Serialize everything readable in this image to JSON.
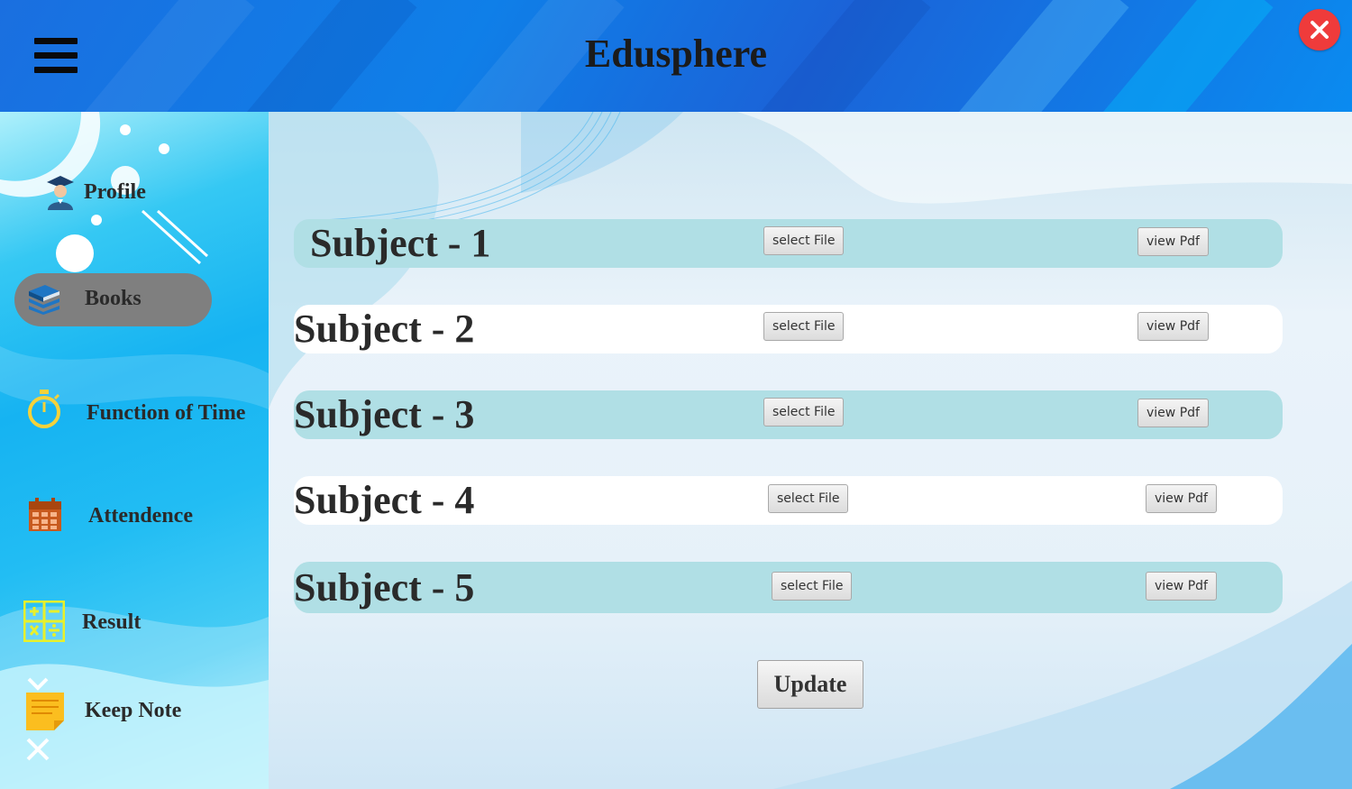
{
  "header": {
    "title": "Edusphere",
    "menu_icon": "hamburger-menu-icon",
    "close_icon": "close-icon"
  },
  "sidebar": {
    "items": [
      {
        "label": "Profile",
        "icon": "graduate-icon"
      },
      {
        "label": "Books",
        "icon": "books-icon",
        "selected": true
      },
      {
        "label": "Function of Time",
        "icon": "stopwatch-icon"
      },
      {
        "label": "Attendence",
        "icon": "calendar-icon"
      },
      {
        "label": "Result",
        "icon": "calculator-icon"
      },
      {
        "label": "Keep Note",
        "icon": "sticky-note-icon"
      }
    ]
  },
  "main": {
    "subjects": [
      {
        "title": "Subject - 1",
        "select_label": "select File",
        "view_label": "view Pdf"
      },
      {
        "title": "Subject - 2",
        "select_label": "select File",
        "view_label": "view Pdf"
      },
      {
        "title": "Subject - 3",
        "select_label": "select File",
        "view_label": "view Pdf"
      },
      {
        "title": "Subject - 4",
        "select_label": "select File",
        "view_label": "view Pdf"
      },
      {
        "title": "Subject - 5",
        "select_label": "select File",
        "view_label": "view Pdf"
      }
    ],
    "update_label": "Update"
  },
  "colors": {
    "header": "#1a6fe0",
    "close": "#ef3b3b",
    "selected_pill": "#7f7f7f",
    "row_teal": "#b0dfe5",
    "row_white": "#ffffff"
  }
}
